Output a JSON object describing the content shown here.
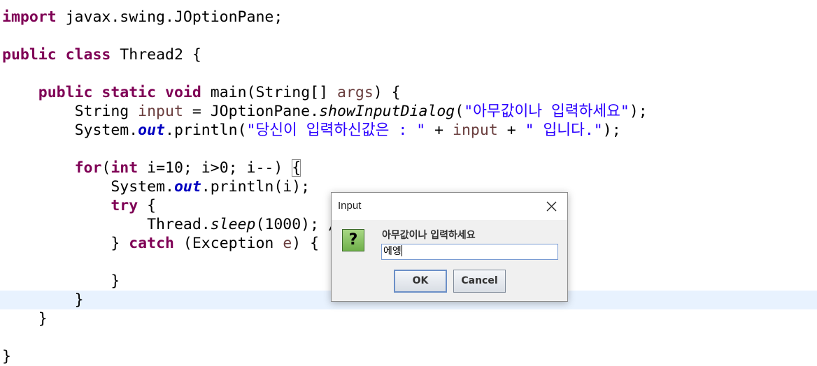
{
  "editor": {
    "lines": {
      "l1": {
        "import_kw": "import",
        "rest": " javax.swing.JOptionPane;"
      },
      "l2": {
        "public_kw": "public",
        "class_kw": "class",
        "rest": " Thread2 {"
      },
      "l3": {
        "public_kw": "public",
        "static_kw": "static",
        "void_kw": "void",
        "main": " main(String[] ",
        "args": "args",
        "close": ") {"
      },
      "l4": {
        "type": "String ",
        "var": "input",
        "eq": " = JOptionPane.",
        "method": "showInputDialog",
        "open": "(",
        "str": "\"아무값이나 입력하세요\"",
        "close": ");"
      },
      "l5": {
        "sys": "System.",
        "out": "out",
        "call": ".println(",
        "str1": "\"당신이 입력하신값은 : \"",
        "plus1": " + ",
        "var": "input",
        "plus2": " + ",
        "str2": "\" 입니다.\"",
        "close": ");"
      },
      "l6": {
        "for_kw": "for",
        "open": "(",
        "int_kw": "int",
        "i1": " i=10; i>0; i--) ",
        "brace": "{"
      },
      "l7": {
        "sys": "System.",
        "out": "out",
        "call": ".println(i);"
      },
      "l8": {
        "try_kw": "try",
        "rest": " {"
      },
      "l9": {
        "cls": "Thread.",
        "sleep": "sleep",
        "rest": "(1000); /"
      },
      "l10": {
        "brace": "} ",
        "catch_kw": "catch",
        "mid": " (Exception ",
        "var": "e",
        "rest": ") {"
      },
      "l11": {
        "text": "}"
      },
      "l12": {
        "text": "}"
      },
      "l13": {
        "text": "}"
      },
      "l14": {
        "text": "}"
      }
    }
  },
  "dialog": {
    "title": "Input",
    "message": "아무값이나 입력하세요",
    "input_value": "에엥",
    "ok_label": "OK",
    "cancel_label": "Cancel",
    "icon_glyph": "?",
    "icon_name": "question-icon",
    "close_icon_name": "close-icon"
  }
}
